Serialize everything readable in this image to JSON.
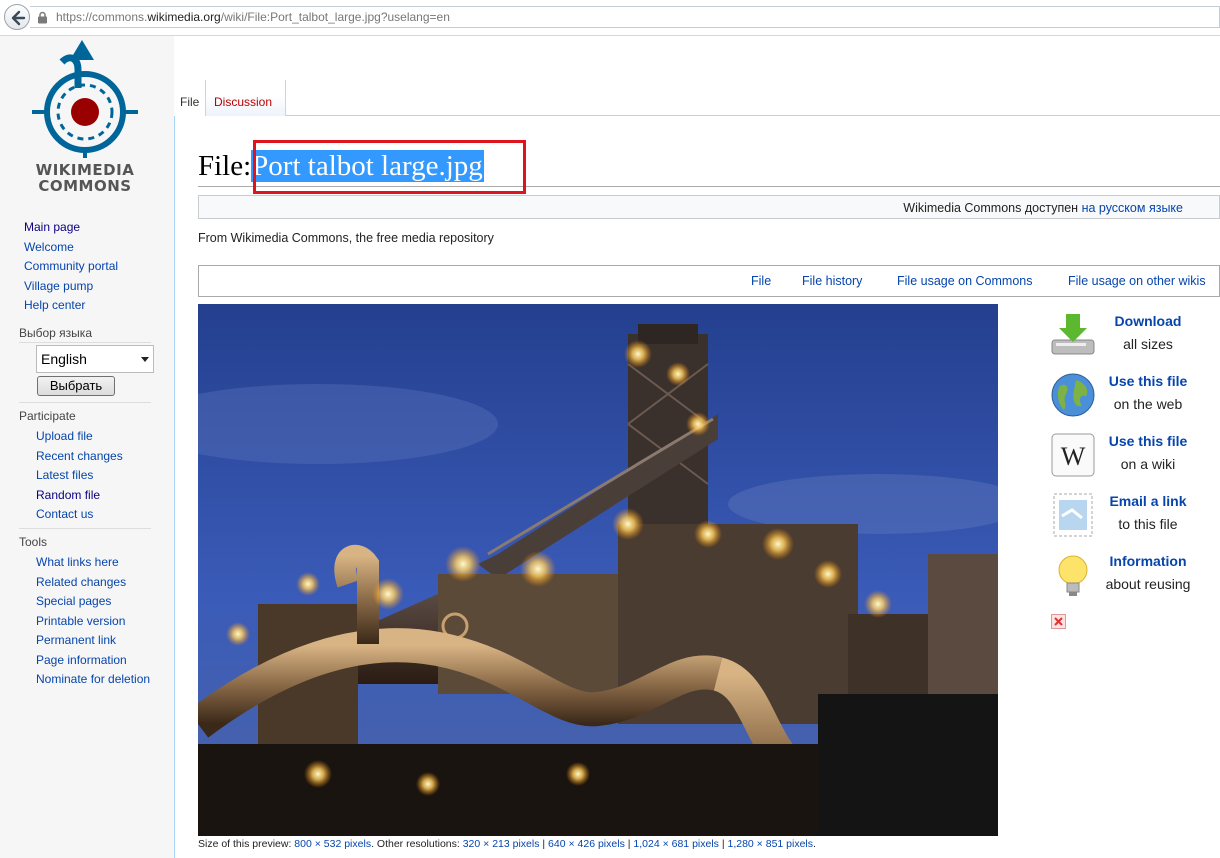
{
  "browser": {
    "url_prefix": "https://commons.",
    "url_domain": "wikimedia.org",
    "url_suffix": "/wiki/File:Port_talbot_large.jpg?uselang=en"
  },
  "logo": {
    "line1": "WIKIMEDIA",
    "line2": "COMMONS"
  },
  "sidebar": {
    "main_nav": [
      "Main page",
      "Welcome",
      "Community portal",
      "Village pump",
      "Help center"
    ],
    "language_heading": "Выбор языка",
    "language_selected": "English",
    "language_button": "Выбрать",
    "participate_heading": "Participate",
    "participate": [
      "Upload file",
      "Recent changes",
      "Latest files",
      "Random file",
      "Contact us"
    ],
    "tools_heading": "Tools",
    "tools": [
      "What links here",
      "Related changes",
      "Special pages",
      "Printable version",
      "Permanent link",
      "Page information",
      "Nominate for deletion"
    ]
  },
  "tabs": {
    "file": "File",
    "discussion": "Discussion"
  },
  "page": {
    "title_prefix": "File:",
    "title_name": "Port talbot large.jpg",
    "lang_notice_text": "Wikimedia Commons доступен",
    "lang_notice_link": "на русском языке",
    "tagline": "From Wikimedia Commons, the free media repository"
  },
  "file_toc": [
    "File",
    "File history",
    "File usage on Commons",
    "File usage on other wikis"
  ],
  "caption": {
    "prefix": "Size of this preview: ",
    "preview_size": "800 × 532 pixels",
    "mid": ". Other resolutions: ",
    "res1": "320 × 213 pixels",
    "sep": " | ",
    "res2": "640 × 426 pixels",
    "res3": "1,024 × 681 pixels",
    "res4": "1,280 × 851 pixels",
    "end": "."
  },
  "actions": [
    {
      "label": "Download",
      "sub": "all sizes",
      "icon": "download-icon"
    },
    {
      "label": "Use this file",
      "sub": "on the web",
      "icon": "globe-icon"
    },
    {
      "label": "Use this file",
      "sub": "on a wiki",
      "icon": "wikipedia-icon"
    },
    {
      "label": "Email a link",
      "sub": "to this file",
      "icon": "email-icon"
    },
    {
      "label": "Information",
      "sub": "about reusing",
      "icon": "lightbulb-icon"
    }
  ],
  "colors": {
    "link": "#0645ad",
    "highlight_box": "#e0141e",
    "selection": "#3399ff"
  }
}
